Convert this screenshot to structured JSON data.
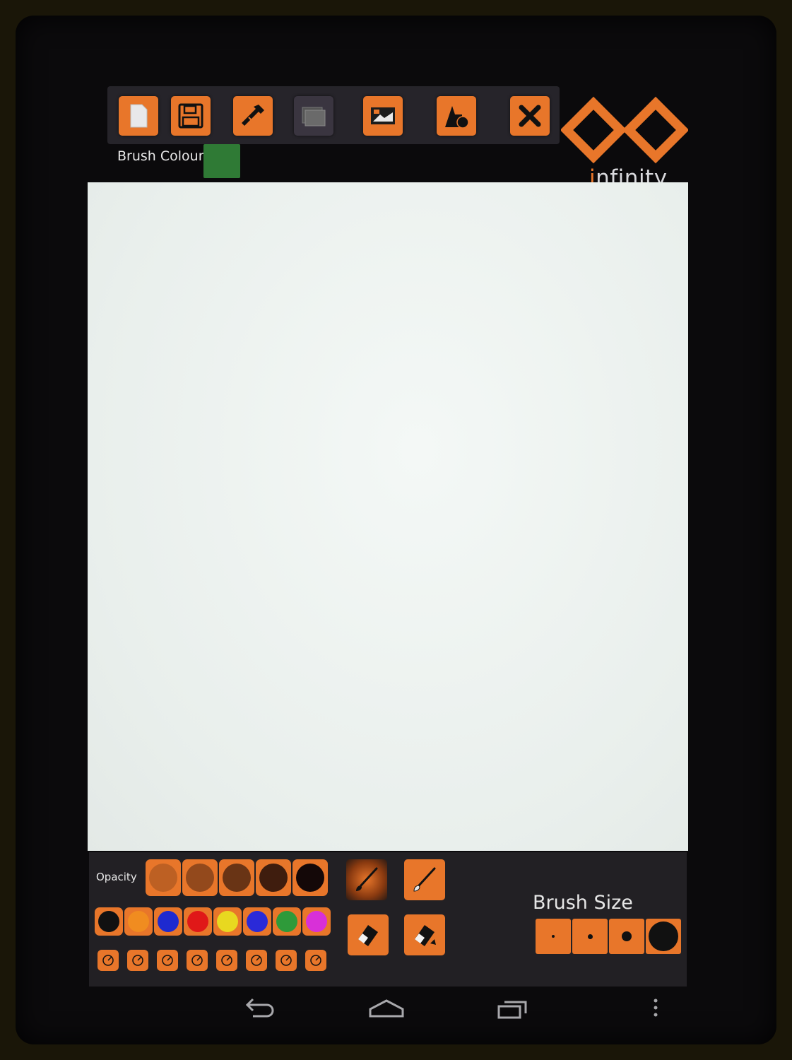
{
  "app": {
    "logo_text_accent": "i",
    "logo_text_rest": "nfinity",
    "brush_colour_label": "Brush Colour",
    "brush_colour_value": "#2f7a35",
    "accent_color": "#e8762a"
  },
  "toolbar": {
    "buttons": [
      {
        "name": "new-page",
        "icon": "blank-page-icon"
      },
      {
        "name": "save",
        "icon": "floppy-disk-icon"
      },
      {
        "name": "eyedropper",
        "icon": "eyedropper-icon"
      },
      {
        "name": "layers",
        "icon": "layers-icon"
      },
      {
        "name": "image",
        "icon": "image-icon"
      },
      {
        "name": "shapes",
        "icon": "shapes-icon"
      },
      {
        "name": "close",
        "icon": "close-icon"
      }
    ]
  },
  "bottom": {
    "opacity_label": "Opacity",
    "opacity_levels": [
      0.2,
      0.4,
      0.6,
      0.8,
      1.0
    ],
    "palette_colors": [
      "#111111",
      "#f08c20",
      "#1e2ad0",
      "#e01818",
      "#e8d820",
      "#2a2ad8",
      "#2e9a3a",
      "#d830d8"
    ],
    "tools": [
      "brush-icon",
      "brush-icon",
      "eraser-icon",
      "eraser-icon"
    ],
    "brush_size_label": "Brush Size",
    "brush_sizes": [
      "tiny",
      "small",
      "medium",
      "large"
    ]
  },
  "navbar": {
    "icons": [
      "back-icon",
      "home-icon",
      "recent-apps-icon",
      "menu-icon"
    ]
  }
}
